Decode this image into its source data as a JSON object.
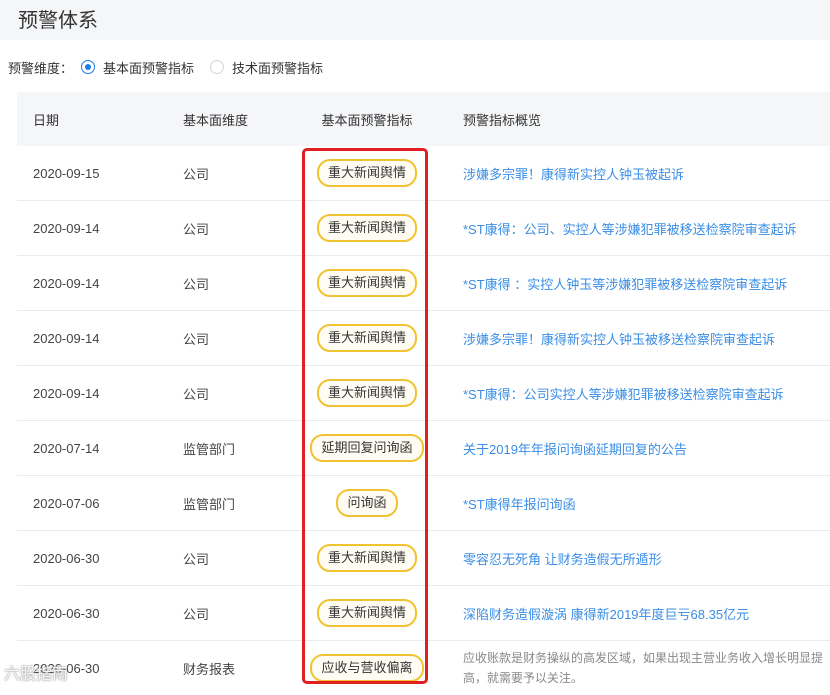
{
  "header": {
    "title": "预警体系"
  },
  "dimension": {
    "label": "预警维度：",
    "options": [
      {
        "label": "基本面预警指标",
        "checked": true
      },
      {
        "label": "技术面预警指标",
        "checked": false
      }
    ]
  },
  "table": {
    "columns": [
      "日期",
      "基本面维度",
      "基本面预警指标",
      "预警指标概览"
    ],
    "rows": [
      {
        "date": "2020-09-15",
        "dimension": "公司",
        "indicator": "重大新闻舆情",
        "summary": "涉嫌多宗罪！康得新实控人钟玉被起诉"
      },
      {
        "date": "2020-09-14",
        "dimension": "公司",
        "indicator": "重大新闻舆情",
        "summary": "*ST康得：公司、实控人等涉嫌犯罪被移送检察院审查起诉"
      },
      {
        "date": "2020-09-14",
        "dimension": "公司",
        "indicator": "重大新闻舆情",
        "summary": "*ST康得 ：实控人钟玉等涉嫌犯罪被移送检察院审查起诉"
      },
      {
        "date": "2020-09-14",
        "dimension": "公司",
        "indicator": "重大新闻舆情",
        "summary": "涉嫌多宗罪！康得新实控人钟玉被移送检察院审查起诉"
      },
      {
        "date": "2020-09-14",
        "dimension": "公司",
        "indicator": "重大新闻舆情",
        "summary": "*ST康得：公司实控人等涉嫌犯罪被移送检察院审查起诉"
      },
      {
        "date": "2020-07-14",
        "dimension": "监管部门",
        "indicator": "延期回复问询函",
        "summary": "关于2019年年报问询函延期回复的公告"
      },
      {
        "date": "2020-07-06",
        "dimension": "监管部门",
        "indicator": "问询函",
        "summary": "*ST康得年报问询函"
      },
      {
        "date": "2020-06-30",
        "dimension": "公司",
        "indicator": "重大新闻舆情",
        "summary": "零容忍无死角 让财务造假无所遁形"
      },
      {
        "date": "2020-06-30",
        "dimension": "公司",
        "indicator": "重大新闻舆情",
        "summary": "深陷财务造假漩涡 康得新2019年度巨亏68.35亿元"
      },
      {
        "date": "2020-06-30",
        "dimension": "财务报表",
        "indicator": "应收与营收偏离",
        "summary": "应收账款是财务操纵的高发区域，如果出现主营业务收入增长明显提高，就需要予以关注。"
      }
    ]
  },
  "colors": {
    "accent": "#1e7ee8",
    "link": "#3a8ee6",
    "tag_border": "#f1c232",
    "highlight": "#e02020"
  },
  "watermark": "六股指南"
}
